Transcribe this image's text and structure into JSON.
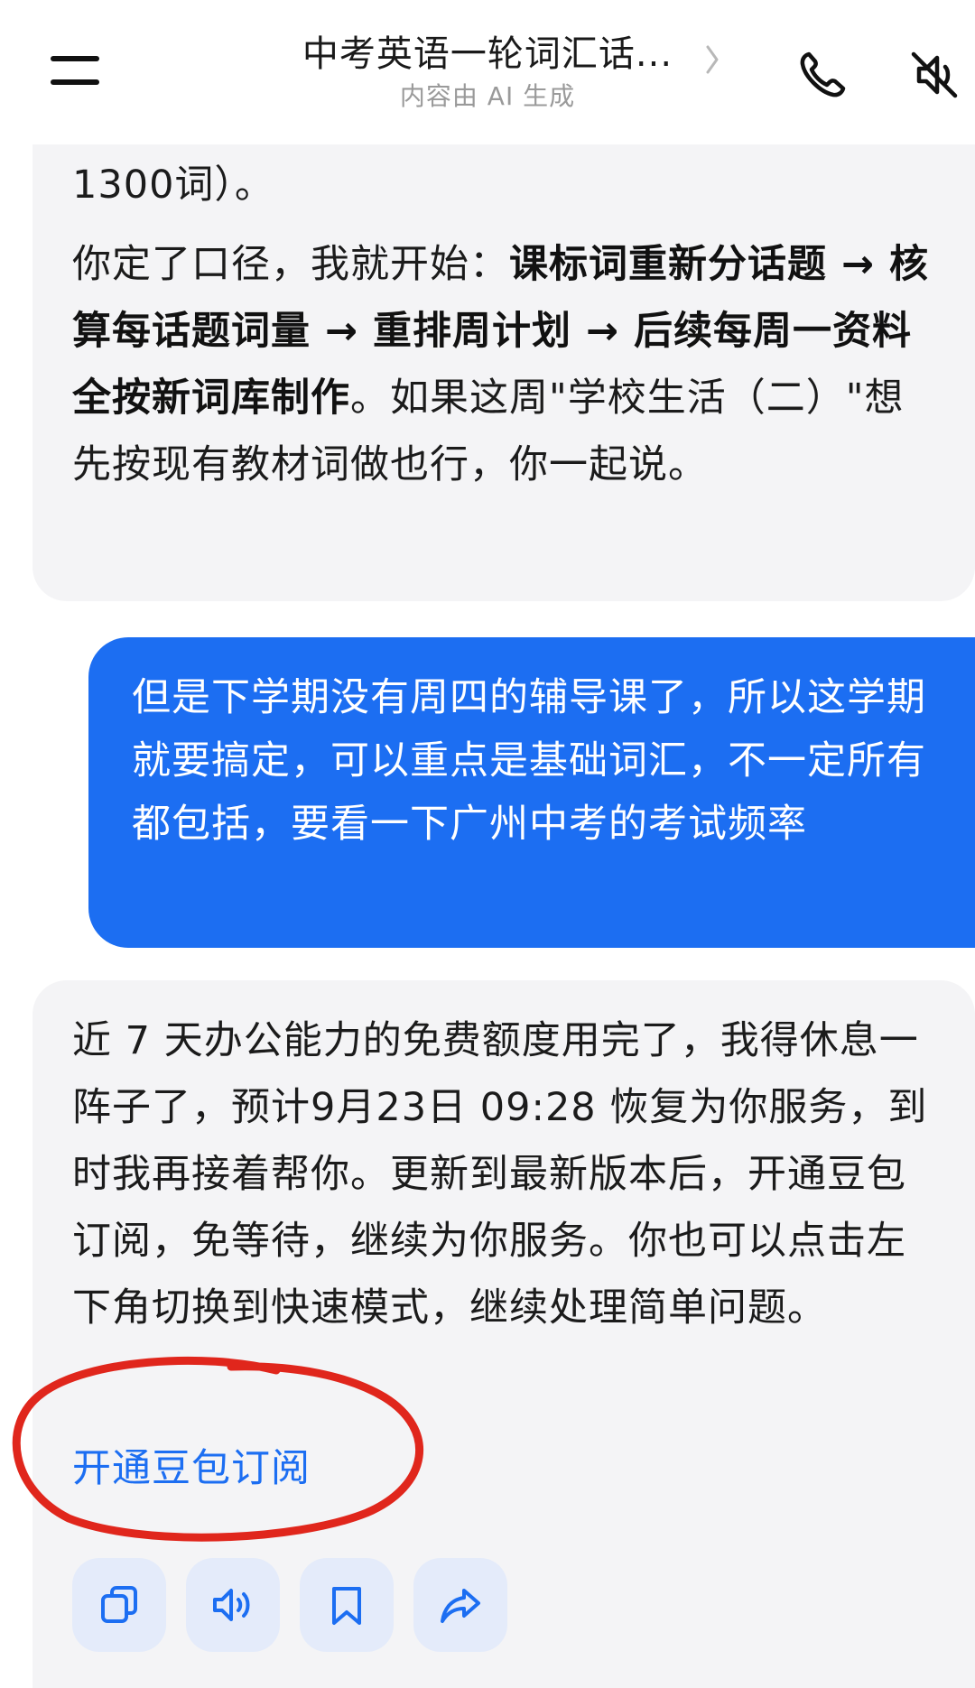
{
  "header": {
    "title": "中考英语一轮词汇话...",
    "subtitle": "内容由 AI 生成",
    "chevron_icon": "chevron-right-icon",
    "call_icon": "phone-icon",
    "mute_icon": "speaker-muted-icon",
    "menu_icon": "menu-icon"
  },
  "messages": {
    "ai_1": {
      "line_tail": "1300词）。",
      "p2_start": "你定了口径，我就开始：",
      "p2_bold": "课标词重新分话题 → 核算每话题词量 → 重排周计划 → 后续每周一资料全按新词库制作",
      "p2_end": "。如果这周\"学校生活（二）\"想先按现有教材词做也行，你一起说。"
    },
    "user_1": {
      "text": "但是下学期没有周四的辅导课了，所以这学期就要搞定，可以重点是基础词汇，不一定所有都包括，要看一下广州中考的考试频率"
    },
    "ai_2": {
      "text": "近 7 天办公能力的免费额度用完了，我得休息一阵子了，预计9月23日 09:28 恢复为你服务，到时我再接着帮你。更新到最新版本后，开通豆包订阅，免等待，继续为你服务。你也可以点击左下角切换到快速模式，继续处理简单问题。",
      "link": "开通豆包订阅"
    }
  },
  "actions": [
    {
      "name": "copy",
      "icon": "copy-icon"
    },
    {
      "name": "read-aloud",
      "icon": "speaker-icon"
    },
    {
      "name": "bookmark",
      "icon": "bookmark-icon"
    },
    {
      "name": "share",
      "icon": "share-icon"
    }
  ],
  "colors": {
    "accent": "#1c6ef2",
    "ai_bubble": "#f4f4f6",
    "action_bg": "#e4ebfa",
    "annotation": "#e0261c"
  }
}
